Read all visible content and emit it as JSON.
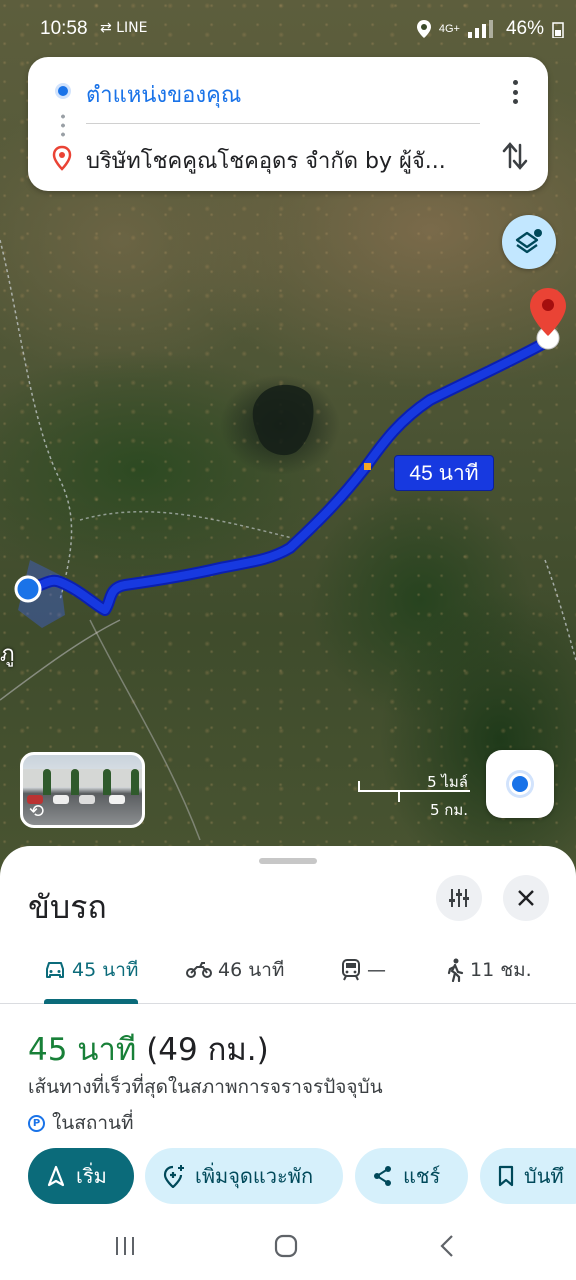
{
  "status_bar": {
    "time": "10:58",
    "left_icons": "⇄ LINE",
    "battery": "46%",
    "network": "4G+"
  },
  "directions": {
    "origin": "ตำแหน่งของคุณ",
    "destination": "บริษัทโชคคูณโชคอุดร จำกัด by ผู้จั...",
    "icons": [
      "origin-dot-icon",
      "destination-pin-icon",
      "more-vert-icon",
      "swap-icon"
    ]
  },
  "map": {
    "eta_label": "45 นาที",
    "city_label_partial": "ภู",
    "scale": {
      "miles": "5 ไมล์",
      "km": "5 กม."
    },
    "icons": [
      "layers-icon",
      "my-location-icon",
      "street-view-rotate-icon"
    ],
    "colors": {
      "route": "#1739e0",
      "origin": "#1a73e8",
      "destination_pin": "#ea4335"
    }
  },
  "sheet": {
    "title": "ขับรถ",
    "modes": [
      {
        "name": "car",
        "label": "45 นาที",
        "active": true
      },
      {
        "name": "motorcycle",
        "label": "46 นาที",
        "active": false
      },
      {
        "name": "transit",
        "label": "—",
        "active": false
      },
      {
        "name": "walk",
        "label": "11 ชม.",
        "active": false
      }
    ],
    "route": {
      "time": "45 นาที",
      "distance": "(49 กม.)",
      "description": "เส้นทางที่เร็วที่สุดในสภาพการจราจรปัจจุบัน",
      "parking": "ในสถานที่"
    },
    "actions": [
      {
        "label": "เริ่ม",
        "primary": true
      },
      {
        "label": "เพิ่มจุดแวะพัก",
        "primary": false
      },
      {
        "label": "แชร์",
        "primary": false
      },
      {
        "label": "บันทึ",
        "primary": false
      }
    ],
    "accent_color": "#0b6b7a",
    "time_color": "#188038"
  }
}
